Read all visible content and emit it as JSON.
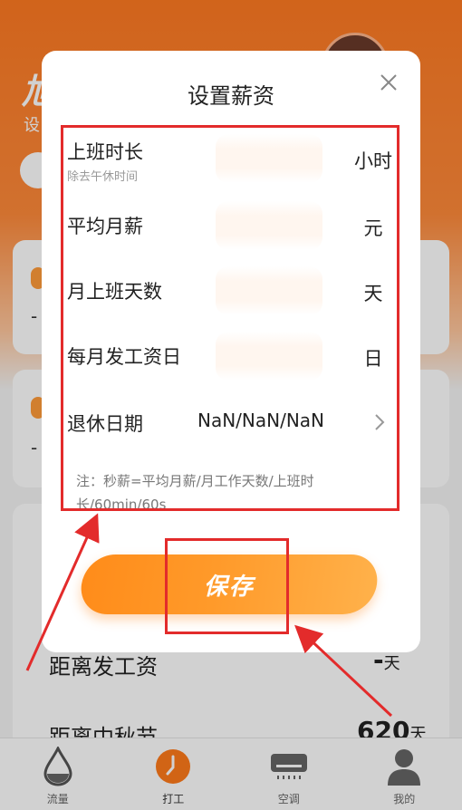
{
  "background": {
    "title": "旭",
    "subtitle": "设",
    "rows": [
      {
        "label": "距离发工资",
        "value": "-",
        "unit": "天"
      },
      {
        "label": "距离中秋节",
        "value": "620",
        "unit": "天"
      }
    ],
    "dash1": "-",
    "dash2": "-"
  },
  "dialog": {
    "title": "设置薪资",
    "fields": {
      "work_hours": {
        "label": "上班时长",
        "hint": "除去午休时间",
        "value": "",
        "unit": "小时"
      },
      "monthly_salary": {
        "label": "平均月薪",
        "value": "",
        "unit": "元"
      },
      "work_days": {
        "label": "月上班天数",
        "value": "",
        "unit": "天"
      },
      "payday": {
        "label": "每月发工资日",
        "value": "",
        "unit": "日"
      },
      "retire_date": {
        "label": "退休日期",
        "value": "NaN/NaN/NaN"
      }
    },
    "note": "注：秒薪=平均月薪/月工作天数/上班时长/60min/60s",
    "save_label": "保存"
  },
  "tabbar": {
    "tabs": [
      {
        "label": "流量",
        "icon": "water-drop-icon"
      },
      {
        "label": "打工",
        "icon": "clock-icon"
      },
      {
        "label": "空调",
        "icon": "air-conditioner-icon"
      },
      {
        "label": "我的",
        "icon": "user-icon"
      }
    ],
    "active_index": 1
  },
  "colors": {
    "accent": "#ff8c1a",
    "annotation": "#e32b2b"
  }
}
